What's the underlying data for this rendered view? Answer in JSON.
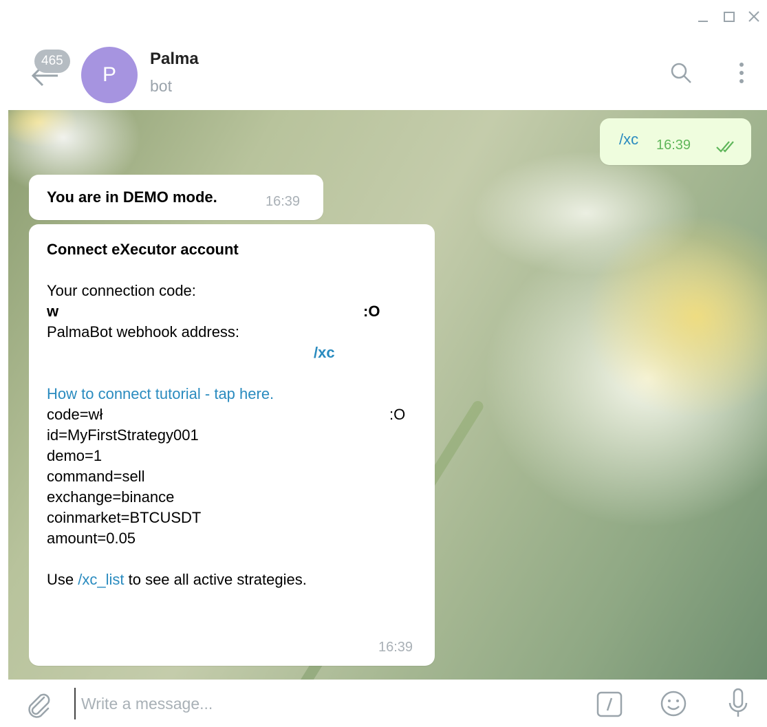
{
  "window": {
    "minimize_icon": "minimize-icon",
    "maximize_icon": "maximize-icon",
    "close_icon": "close-icon"
  },
  "header": {
    "unread_count": "465",
    "avatar_letter": "P",
    "avatar_color": "#a694e0",
    "title": "Palma",
    "subtitle": "bot"
  },
  "messages": {
    "outgoing": {
      "text": "/xc",
      "time": "16:39"
    },
    "demo": {
      "text": "You are in DEMO mode.",
      "time": "16:39"
    },
    "connect": {
      "heading": "Connect eXecutor account",
      "code_label": "Your connection code:",
      "code_start": "w",
      "code_end": ":O",
      "webhook_label": "PalmaBot webhook address:",
      "webhook_end": "/xc",
      "tutorial_link": "How to connect tutorial - tap here.",
      "code_line_start": "code=wł",
      "code_line_end": ":O",
      "id_line": "id=MyFirstStrategy001",
      "demo_line": "demo=1",
      "command_line": "command=sell",
      "exchange_line": "exchange=binance",
      "coinmarket_line": "coinmarket=BTCUSDT",
      "amount_line": "amount=0.05",
      "footer_pre": "Use ",
      "footer_link": "/xc_list",
      "footer_post": " to see all active strategies.",
      "time": "16:39"
    }
  },
  "input": {
    "placeholder": "Write a message..."
  },
  "colors": {
    "link": "#2a8bbf",
    "outgoing_bubble": "#effdde",
    "read_check": "#5fb65a"
  }
}
